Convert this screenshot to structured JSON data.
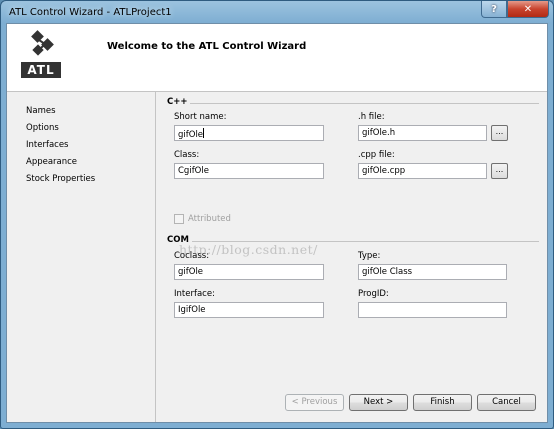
{
  "window": {
    "title": "ATL Control Wizard - ATLProject1",
    "help_label": "?",
    "close_label": "✕"
  },
  "header": {
    "logo_text": "ATL",
    "title": "Welcome to the ATL Control Wizard"
  },
  "sidebar": {
    "items": [
      {
        "label": "Names"
      },
      {
        "label": "Options"
      },
      {
        "label": "Interfaces"
      },
      {
        "label": "Appearance"
      },
      {
        "label": "Stock Properties"
      }
    ]
  },
  "cpp": {
    "heading": "C++",
    "short_name": {
      "label": "Short name:",
      "value": "gifOle"
    },
    "h_file": {
      "label": ".h file:",
      "value": "gifOle.h"
    },
    "class": {
      "label": "Class:",
      "value": "CgifOle"
    },
    "cpp_file": {
      "label": ".cpp file:",
      "value": "gifOle.cpp"
    },
    "browse_label": "...",
    "attributed_label": "Attributed"
  },
  "com": {
    "heading": "COM",
    "coclass": {
      "label": "Coclass:",
      "value": "gifOle"
    },
    "type": {
      "label": "Type:",
      "value": "gifOle Class"
    },
    "interface": {
      "label": "Interface:",
      "value": "IgifOle"
    },
    "progid": {
      "label": "ProgID:",
      "value": ""
    }
  },
  "watermark": "http://blog.csdn.net/",
  "buttons": {
    "previous": "< Previous",
    "next": "Next >",
    "finish": "Finish",
    "cancel": "Cancel"
  }
}
